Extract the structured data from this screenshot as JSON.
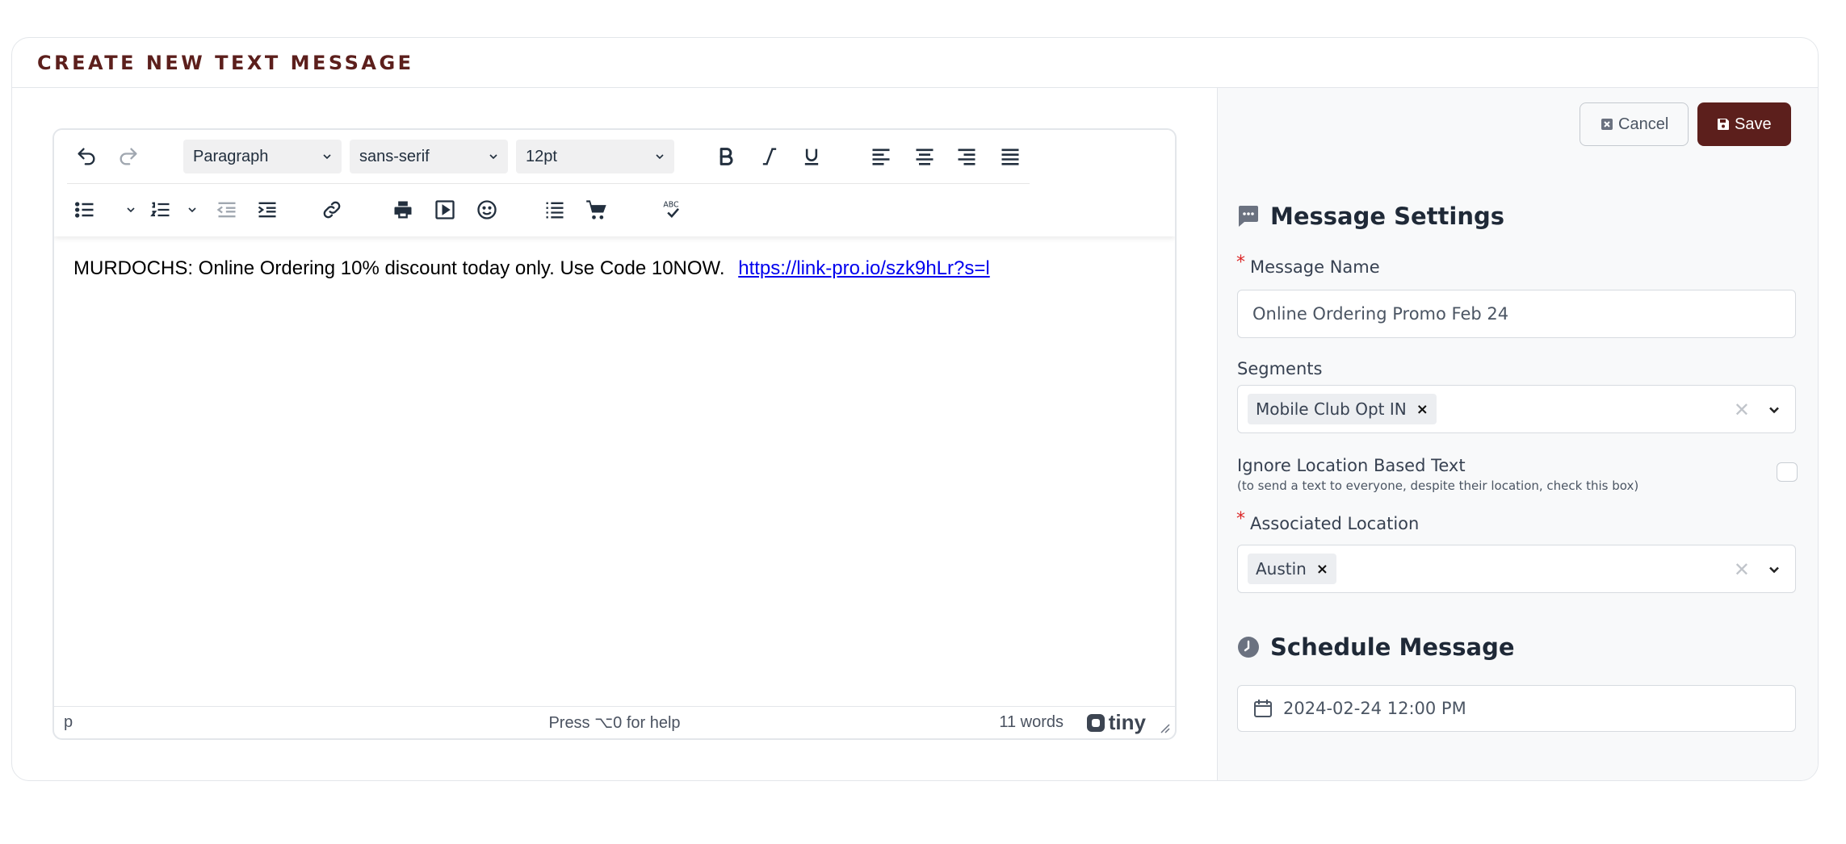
{
  "header": {
    "title": "CREATE NEW TEXT MESSAGE"
  },
  "toolbar": {
    "block_format": "Paragraph",
    "font_family": "sans-serif",
    "font_size": "12pt"
  },
  "editor": {
    "text": "MURDOCHS: Online Ordering 10% discount today only.  Use Code 10NOW.",
    "link": "https://link-pro.io/szk9hLr?s=l",
    "status_path": "p",
    "status_help": "Press ⌥0 for help",
    "word_count": "11 words",
    "brand": "tiny"
  },
  "actions": {
    "cancel_label": "Cancel",
    "save_label": "Save"
  },
  "settings": {
    "title": "Message Settings",
    "name_label": "Message Name",
    "name_value": "Online Ordering Promo Feb 24",
    "segments_label": "Segments",
    "segments": [
      "Mobile Club Opt IN"
    ],
    "ignore_label": "Ignore Location Based Text",
    "ignore_hint": "(to send a text to everyone, despite their location, check this box)",
    "location_label": "Associated Location",
    "locations": [
      "Austin"
    ],
    "required_mark": "*",
    "clear_mark": "✕",
    "remove_mark": "×"
  },
  "schedule": {
    "title": "Schedule Message",
    "datetime": "2024-02-24 12:00 PM"
  },
  "colors": {
    "brand": "#5c1f1c",
    "link": "#0000ee"
  },
  "icons": [
    "undo-icon",
    "redo-icon",
    "bold-icon",
    "italic-icon",
    "underline-icon",
    "align-left-icon",
    "align-center-icon",
    "align-right-icon",
    "justify-icon",
    "bullet-list-icon",
    "numbered-list-icon",
    "outdent-icon",
    "indent-icon",
    "link-icon",
    "print-icon",
    "media-icon",
    "emoji-icon",
    "toc-icon",
    "cart-icon",
    "spellcheck-icon",
    "message-icon",
    "clock-icon",
    "calendar-icon"
  ]
}
